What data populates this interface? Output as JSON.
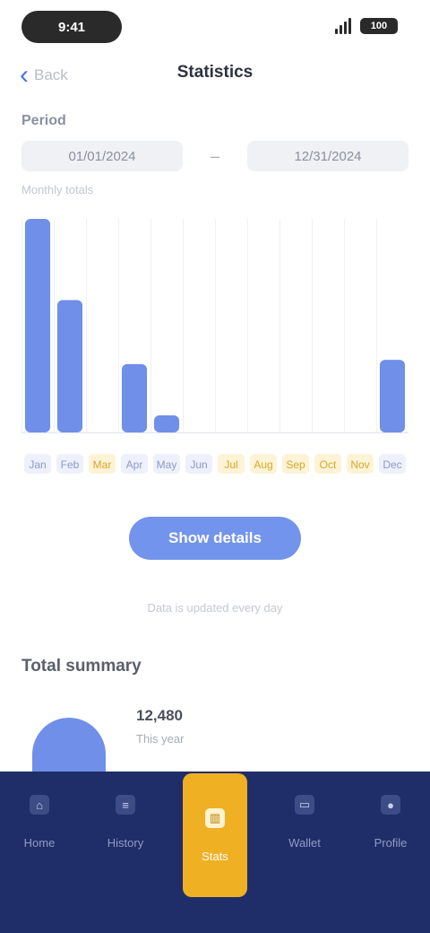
{
  "status_bar": {
    "time": "9:41",
    "battery": "100"
  },
  "nav": {
    "back_label": "Back",
    "title": "Statistics"
  },
  "period": {
    "label": "Period",
    "start": "01/01/2024",
    "separator": "–",
    "end": "12/31/2024",
    "note": "Monthly totals"
  },
  "chart_data": {
    "type": "bar",
    "categories": [
      "Jan",
      "Feb",
      "Mar",
      "Apr",
      "May",
      "Jun",
      "Jul",
      "Aug",
      "Sep",
      "Oct",
      "Nov",
      "Dec"
    ],
    "series": [
      {
        "values": [
          100,
          62,
          0,
          32,
          8,
          0,
          0,
          0,
          0,
          0,
          0,
          34
        ]
      }
    ],
    "ylim": [
      0,
      100
    ],
    "grid": true,
    "bar_color": "#6f8fe8",
    "highlight_color": "#f2c24e",
    "highlighted_categories": [
      "Mar",
      "Jul",
      "Aug",
      "Sep",
      "Oct",
      "Nov"
    ]
  },
  "actions": {
    "primary": "Show details"
  },
  "footnote": "Data is updated every day",
  "summary": {
    "title": "Total summary",
    "value": "12,480",
    "sub": "This year"
  },
  "tabs": [
    {
      "icon": "home-icon",
      "glyph": "⌂",
      "label": "Home"
    },
    {
      "icon": "list-icon",
      "glyph": "≡",
      "label": "History"
    },
    {
      "icon": "chart-icon",
      "glyph": "▥",
      "label": "Stats",
      "active": true
    },
    {
      "icon": "wallet-icon",
      "glyph": "▭",
      "label": "Wallet"
    },
    {
      "icon": "profile-icon",
      "glyph": "●",
      "label": "Profile"
    }
  ],
  "colors": {
    "accent": "#6f8fe8",
    "nav_bg": "#1f2e68",
    "active_tab": "#f0b024"
  }
}
